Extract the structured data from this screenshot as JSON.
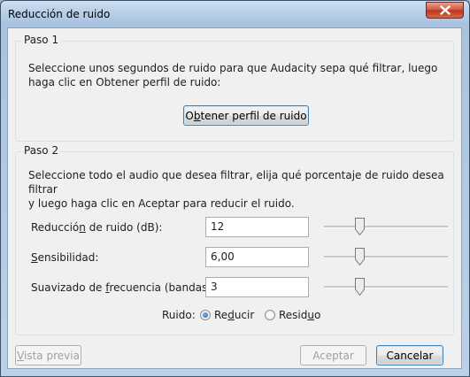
{
  "window": {
    "title": "Reducción de ruido"
  },
  "step1": {
    "legend": "Paso 1",
    "line1": "Seleccione unos segundos de ruido para que Audacity sepa qué filtrar, luego",
    "line2": "haga clic en Obtener perfil de ruido:",
    "button": {
      "before": "O",
      "mnemonic": "b",
      "after": "tener perfil de ruido"
    }
  },
  "step2": {
    "legend": "Paso 2",
    "line1": "Seleccione todo el audio que desea filtrar, elija qué porcentaje de ruido desea filtrar",
    "line2": "y luego haga clic en Aceptar para reducir el ruido.",
    "params": [
      {
        "before": "Reducció",
        "mnemonic": "n",
        "after": " de ruido (dB):",
        "value": "12",
        "slider_fraction": 0.27
      },
      {
        "before": "",
        "mnemonic": "S",
        "after": "ensibilidad:",
        "value": "6,00",
        "slider_fraction": 0.27
      },
      {
        "before": "Suavizado de ",
        "mnemonic": "f",
        "after": "recuencia (bandas):",
        "value": "3",
        "slider_fraction": 0.27
      }
    ],
    "noise_label": "Ruido:",
    "options": [
      {
        "before": "Re",
        "mnemonic": "d",
        "after": "ucir",
        "selected": true
      },
      {
        "before": "Resid",
        "mnemonic": "u",
        "after": "o",
        "selected": false
      }
    ]
  },
  "buttons": {
    "preview": {
      "before": "",
      "mnemonic": "V",
      "after": "ista previa"
    },
    "accept": "Aceptar",
    "cancel": "Cancelar"
  },
  "colors": {
    "close_button": "#c0301b",
    "default_button_border": "#3c7fb1",
    "radio_dot": "#1a5fa8"
  }
}
